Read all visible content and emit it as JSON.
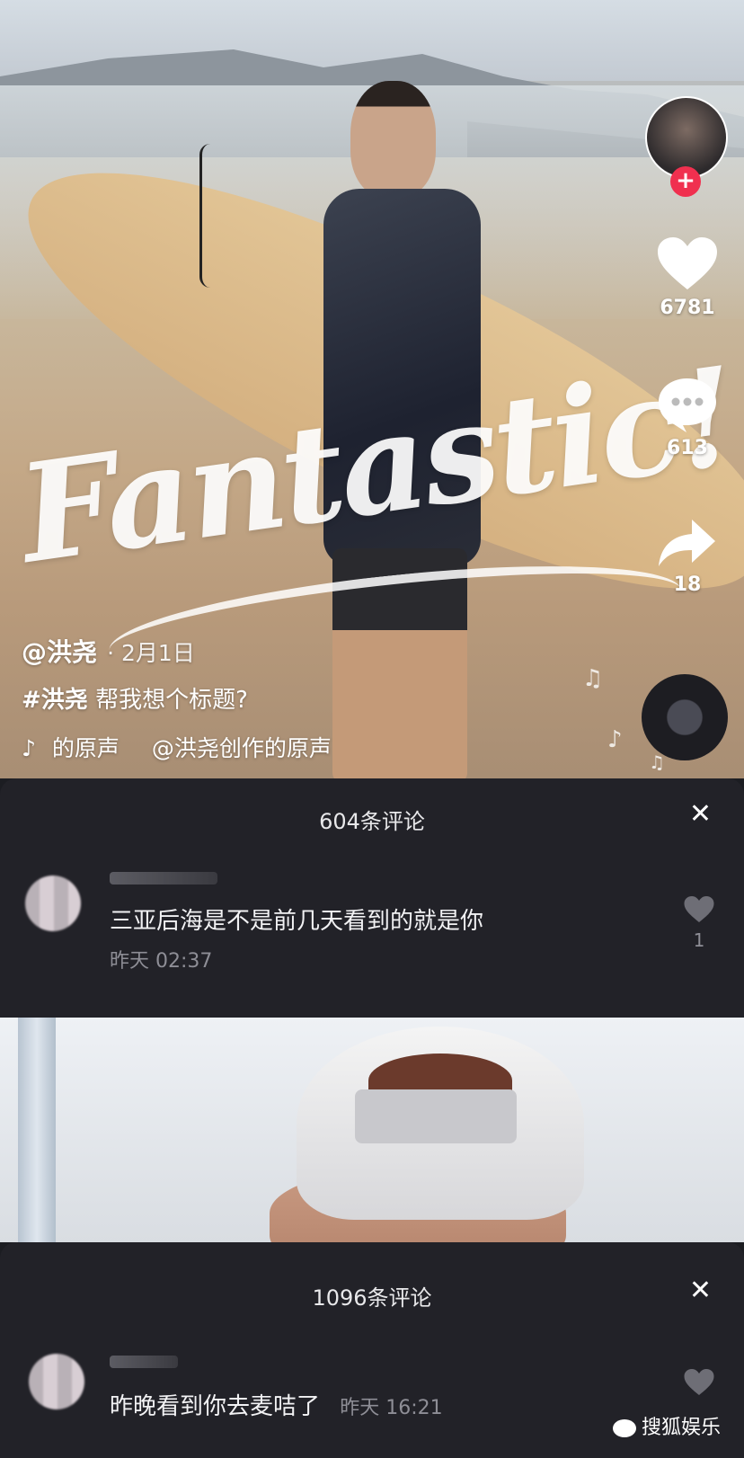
{
  "video1": {
    "overlay_text": "Fantastic!",
    "author": "@洪尧",
    "date": "· 2月1日",
    "hashtag": "#洪尧",
    "caption": "帮我想个标题?",
    "music_icon": "tiktok-icon",
    "music_label": "的原声",
    "music_source": "@洪尧创作的原声",
    "likes": "6781",
    "comments": "613",
    "shares": "18",
    "follow": "+"
  },
  "panel1": {
    "title": "604条评论",
    "close": "✕",
    "comment": {
      "text": "三亚后海是不是前几天看到的就是你",
      "time": "昨天 02:37",
      "likes": "1"
    }
  },
  "panel2": {
    "title": "1096条评论",
    "close": "✕",
    "comment": {
      "text": "昨晚看到你去麦咭了",
      "time": "昨天 16:21"
    }
  },
  "watermark": "搜狐娱乐",
  "colors": {
    "follow_red": "#f0304f",
    "panel_bg": "#222228"
  }
}
